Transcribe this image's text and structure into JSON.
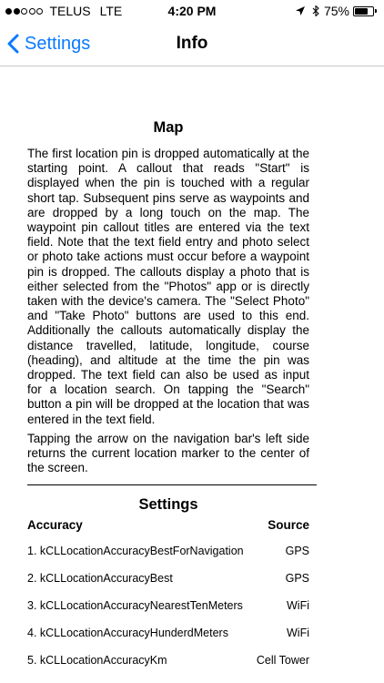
{
  "status_bar": {
    "carrier": "TELUS",
    "network": "LTE",
    "time": "4:20 PM",
    "battery": "75%",
    "battery_level": 0.75,
    "signal_bars_filled": 2,
    "signal_bars_total": 5
  },
  "nav": {
    "back_label": "Settings",
    "title": "Info"
  },
  "map_section": {
    "title": "Map",
    "paragraph1": "The first location pin is dropped automatically at the starting point. A callout that reads \"Start\" is displayed when the pin is touched with a regular short tap. Subsequent pins serve as waypoints and are dropped by a long touch on the map. The waypoint pin callout titles are entered via the text field. Note that the text field entry and photo select or photo take actions must occur before a waypoint pin is dropped. The callouts display a photo that is either selected from the \"Photos\" app or is directly taken with the device's camera. The \"Select Photo\" and \"Take Photo\" buttons are used to this end. Additionally the callouts automatically display the distance travelled, latitude, longitude, course (heading), and altitude at the time the pin was dropped. The text field can also be used as input for a location search. On tapping the \"Search\" button  a pin will be dropped at the location that was entered in the text field.",
    "paragraph2": "Tapping the arrow on the navigation bar's left side returns the current location marker to the center of the screen."
  },
  "settings_section": {
    "title": "Settings",
    "headers": {
      "accuracy": "Accuracy",
      "source": "Source"
    },
    "rows": [
      {
        "accuracy": "1. kCLLocationAccuracyBestForNavigation",
        "source": "GPS"
      },
      {
        "accuracy": "2. kCLLocationAccuracyBest",
        "source": "GPS"
      },
      {
        "accuracy": "3. kCLLocationAccuracyNearestTenMeters",
        "source": "WiFi"
      },
      {
        "accuracy": "4. kCLLocationAccuracyHunderdMeters",
        "source": "WiFi"
      },
      {
        "accuracy": "5. kCLLocationAccuracyKm",
        "source": "Cell Tower"
      }
    ]
  },
  "icons": {
    "back": "chevron-left-icon",
    "location": "location-arrow-icon",
    "bluetooth": "bluetooth-icon",
    "battery": "battery-icon"
  },
  "colors": {
    "accent": "#0a7aff",
    "separator": "#c8c7cc"
  }
}
